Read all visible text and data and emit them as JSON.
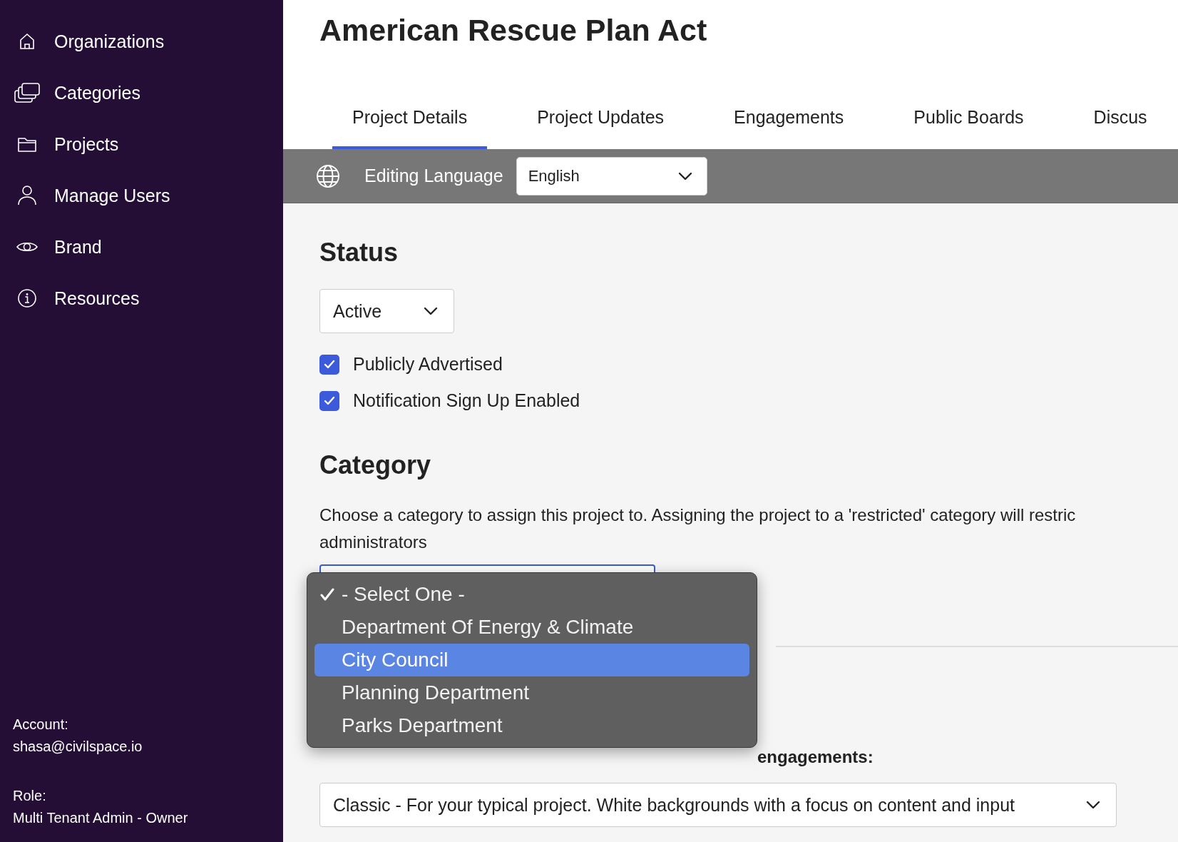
{
  "sidebar": {
    "items": [
      {
        "label": "Organizations"
      },
      {
        "label": "Categories"
      },
      {
        "label": "Projects"
      },
      {
        "label": "Manage Users"
      },
      {
        "label": "Brand"
      },
      {
        "label": "Resources"
      }
    ],
    "account_label": "Account:",
    "account": "shasa@civilspace.io",
    "role_label": "Role:",
    "role": "Multi Tenant Admin - Owner"
  },
  "title": "American Rescue Plan Act",
  "tabs": [
    {
      "label": "Project Details",
      "selected": true
    },
    {
      "label": "Project Updates",
      "selected": false
    },
    {
      "label": "Engagements",
      "selected": false
    },
    {
      "label": "Public Boards",
      "selected": false
    },
    {
      "label": "Discus",
      "selected": false
    }
  ],
  "language_bar": {
    "label": "Editing Language",
    "value": "English"
  },
  "status": {
    "heading": "Status",
    "value": "Active",
    "checkboxes": [
      {
        "label": "Publicly Advertised",
        "checked": true
      },
      {
        "label": "Notification Sign Up Enabled",
        "checked": true
      }
    ]
  },
  "category": {
    "heading": "Category",
    "description": "Choose a category to assign this project to. Assigning the project to a 'restricted' category will restric",
    "description_2": "administrators",
    "options": [
      {
        "label": "- Select One -",
        "checked": true,
        "selected": false
      },
      {
        "label": "Department Of Energy & Climate",
        "checked": false,
        "selected": false
      },
      {
        "label": "City Council",
        "checked": false,
        "selected": true
      },
      {
        "label": "Planning Department",
        "checked": false,
        "selected": false
      },
      {
        "label": "Parks Department",
        "checked": false,
        "selected": false
      }
    ]
  },
  "display_style": {
    "label": "engagements:",
    "value": "Classic - For your typical project. White backgrounds with a focus on content and input"
  }
}
